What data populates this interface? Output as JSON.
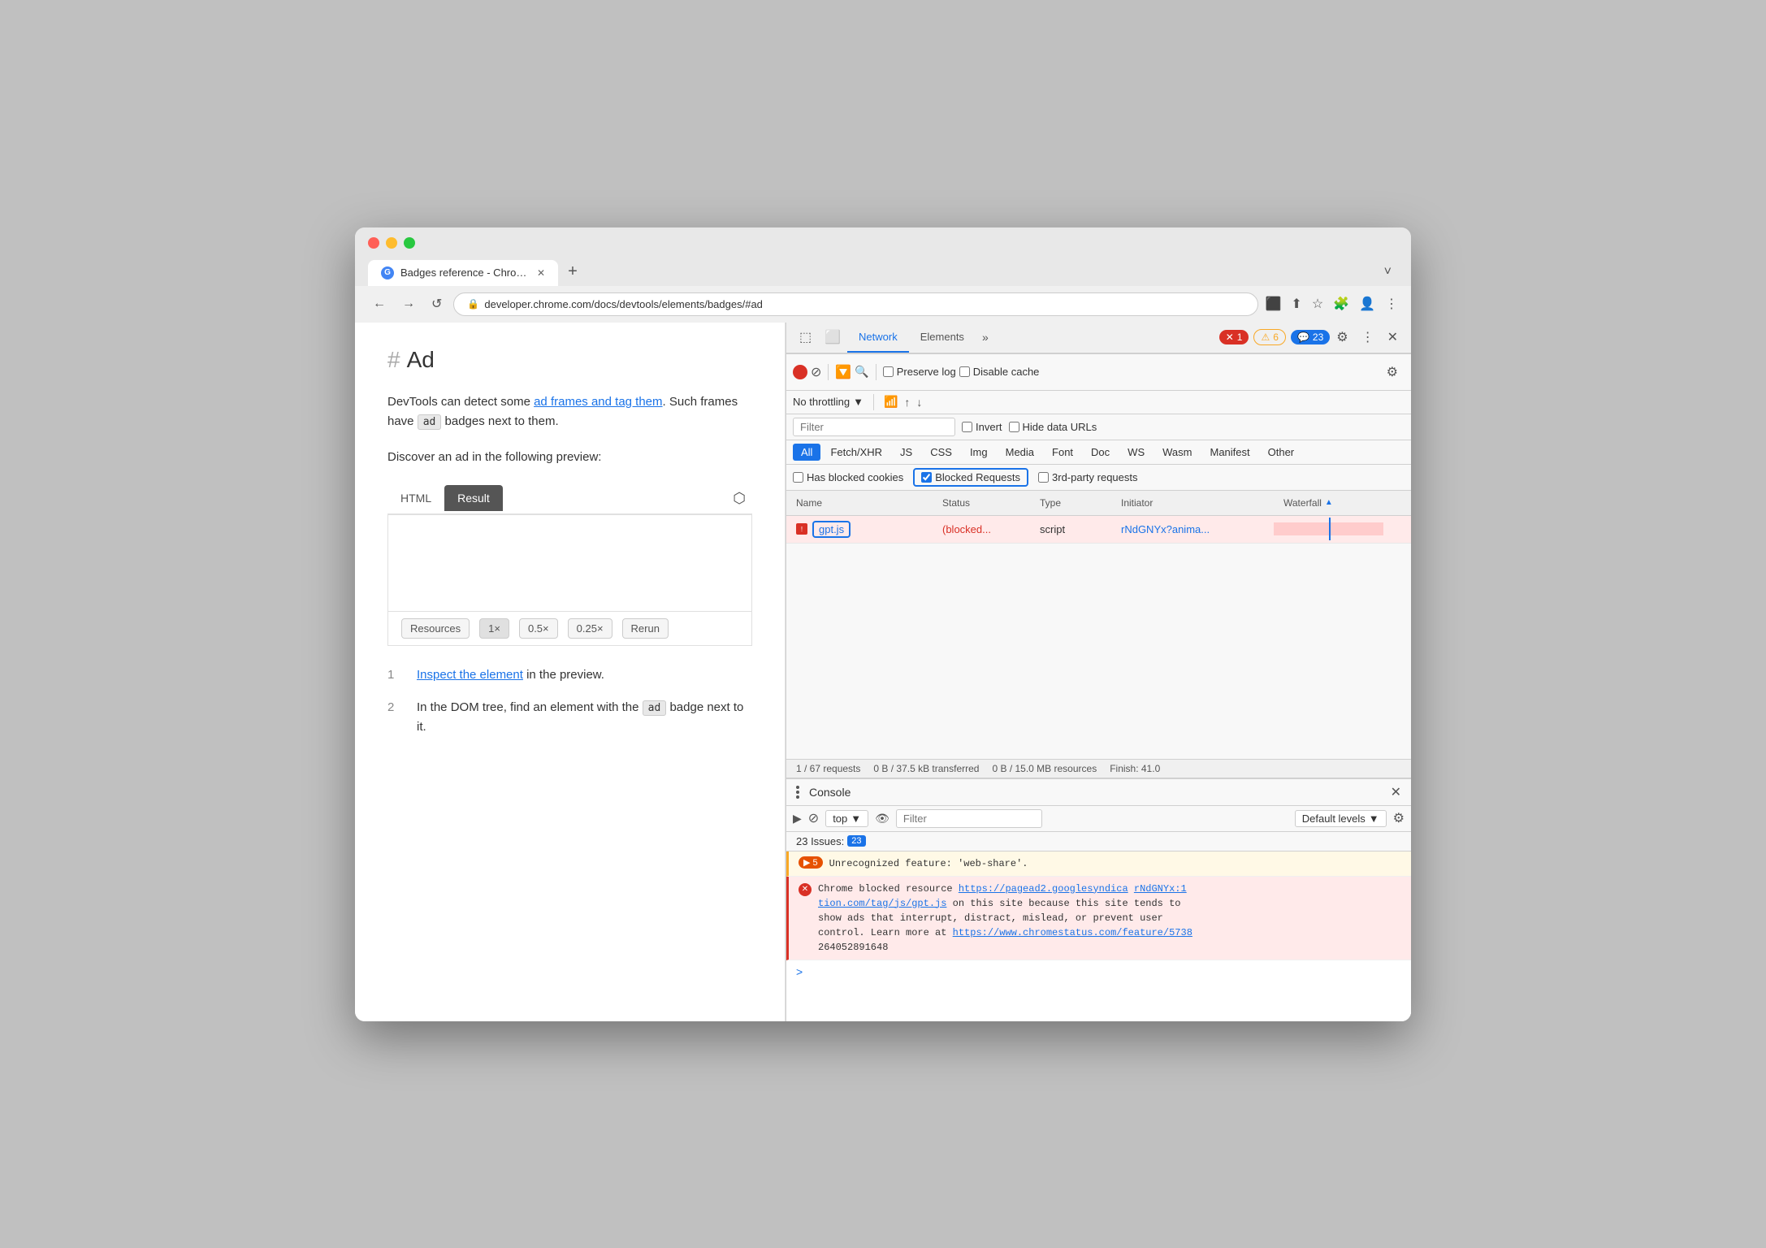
{
  "browser": {
    "tab_title": "Badges reference - Chrome De",
    "tab_favicon": "G",
    "url": "developer.chrome.com/docs/devtools/elements/badges/#ad",
    "new_tab_label": "+",
    "nav_back": "←",
    "nav_forward": "→",
    "nav_refresh": "↺",
    "more_options": "⋮"
  },
  "webpage": {
    "heading_hash": "#",
    "heading": "Ad",
    "paragraph1_pre": "DevTools can detect some ",
    "paragraph1_link1": "ad frames and tag them",
    "paragraph1_mid": ". Such frames have ",
    "paragraph1_badge": "ad",
    "paragraph1_post": " badges next to them.",
    "paragraph2": "Discover an ad in the following preview:",
    "tab_html": "HTML",
    "tab_result": "Result",
    "resources_label": "Resources",
    "btn_1x": "1×",
    "btn_half": "0.5×",
    "btn_quarter": "0.25×",
    "btn_rerun": "Rerun",
    "step1_num": "1",
    "step1_link": "Inspect the element",
    "step1_text": " in the preview.",
    "step2_num": "2",
    "step2_pre": "In the DOM tree, find an element with the ",
    "step2_badge": "ad",
    "step2_post": " badge next to it."
  },
  "devtools": {
    "inspect_icon": "⬚",
    "device_icon": "⬜",
    "tabs": [
      "Network",
      "Elements"
    ],
    "active_tab": "Network",
    "more_tabs": "»",
    "error_badge": "1",
    "warning_badge": "6",
    "info_badge": "23",
    "gear_icon": "⚙",
    "more_icon": "⋮",
    "close_icon": "✕",
    "network": {
      "record_label": "Record",
      "no_entry_label": "⊘",
      "filter_label": "Filter",
      "search_label": "Search",
      "preserve_log": "Preserve log",
      "disable_cache": "Disable cache",
      "settings_icon": "⚙",
      "throttle_label": "No throttling",
      "wifi_icon": "wifi",
      "upload_icon": "↑",
      "download_icon": "↓",
      "filter_placeholder": "Filter",
      "invert_label": "Invert",
      "hide_data_urls": "Hide data URLs",
      "type_filters": [
        "All",
        "Fetch/XHR",
        "JS",
        "CSS",
        "Img",
        "Media",
        "Font",
        "Doc",
        "WS",
        "Wasm",
        "Manifest",
        "Other"
      ],
      "active_type": "All",
      "has_blocked_cookies": "Has blocked cookies",
      "blocked_requests": "Blocked Requests",
      "third_party": "3rd-party requests",
      "columns": {
        "name": "Name",
        "status": "Status",
        "type": "Type",
        "initiator": "Initiator",
        "waterfall": "Waterfall"
      },
      "rows": [
        {
          "name": "gpt.js",
          "status": "(blocked...",
          "type": "script",
          "initiator": "rNdGNYx?anima...",
          "has_bar": true
        }
      ],
      "status_bar": "1 / 67 requests   0 B / 37.5 kB transferred   0 B / 15.0 MB resources   Finish: 41.0"
    },
    "console": {
      "title": "Console",
      "close_label": "✕",
      "exec_icon": "▶",
      "no_entry": "⊘",
      "top_label": "top",
      "eye_icon": "👁",
      "filter_placeholder": "Filter",
      "default_levels": "Default levels",
      "gear_icon": "⚙",
      "issues_label": "23 Issues:",
      "issues_count": "23",
      "messages": [
        {
          "type": "warning",
          "badge": "▶ 5",
          "text": "Unrecognized feature: 'web-share'."
        },
        {
          "type": "error",
          "text": "Chrome blocked resource https://pagead2.googlesyndica rNdGNYx:1\ntion.com/tag/js/gpt.js on this site because this site tends to\nshow ads that interrupt, distract, mislead, or prevent user\ncontrol. Learn more at https://www.chromestatus.com/feature/5738\n264052891648"
        }
      ],
      "prompt_arrow": ">"
    }
  }
}
